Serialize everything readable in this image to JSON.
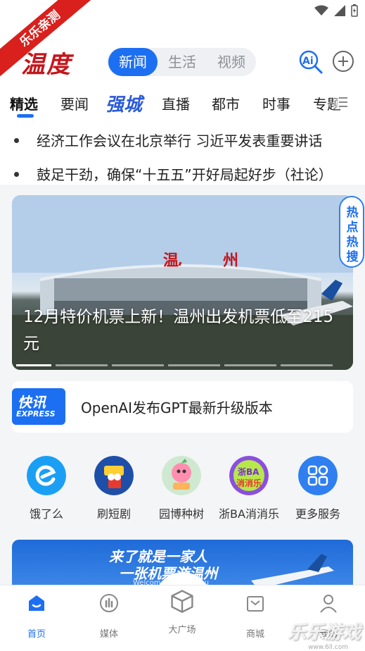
{
  "corner_ribbon": "乐乐亲测",
  "brand": {
    "logo_text": "温度"
  },
  "top_tabs": [
    {
      "label": "新闻",
      "active": true
    },
    {
      "label": "生活",
      "active": false
    },
    {
      "label": "视频",
      "active": false
    }
  ],
  "channels": [
    "精选",
    "要闻",
    "强城",
    "直播",
    "都市",
    "时事",
    "专题"
  ],
  "ticker": [
    "经济工作会议在北京举行 习近平发表重要讲话",
    "鼓足干劲，确保“十五五”开好局起好步（社论）"
  ],
  "banner": {
    "headline": "12月特价机票上新！温州出发机票低至215元",
    "slide_count": 6,
    "active_slide": 1
  },
  "hot_badge": {
    "text": "热点热搜"
  },
  "flash": {
    "logo_text": "快讯",
    "logo_sub": "EXPRESS",
    "text": "OpenAI发布GPT最新升级版本"
  },
  "services": [
    {
      "label": "饿了么",
      "icon": "eleme-icon",
      "color": "#1a9ff5"
    },
    {
      "label": "刷短剧",
      "icon": "short-drama-icon",
      "color": "#1e4fa8"
    },
    {
      "label": "园博种树",
      "icon": "tree-plant-icon",
      "color": "#ffb35a"
    },
    {
      "label": "浙BA消消乐",
      "icon": "match-game-icon",
      "color": "#8a4fe0"
    },
    {
      "label": "更多服务",
      "icon": "more-services-icon",
      "color": "#2f7ff0"
    }
  ],
  "promo": {
    "line1": "来了就是一家人",
    "line2": "一张机票游温州",
    "line3": "Welcome to Wenzhou"
  },
  "bottom_nav": [
    {
      "label": "首页",
      "icon": "home-icon",
      "active": true
    },
    {
      "label": "媒体",
      "icon": "media-icon",
      "active": false
    },
    {
      "label": "大广场",
      "icon": "plaza-icon",
      "active": false
    },
    {
      "label": "商城",
      "icon": "mall-icon",
      "active": false
    },
    {
      "label": "我的",
      "icon": "profile-icon",
      "active": false
    }
  ],
  "watermark": {
    "text": "乐乐游戏",
    "url": "www.6ll.com"
  },
  "colors": {
    "accent": "#1d6ff2",
    "brand_red": "#c4161c"
  }
}
